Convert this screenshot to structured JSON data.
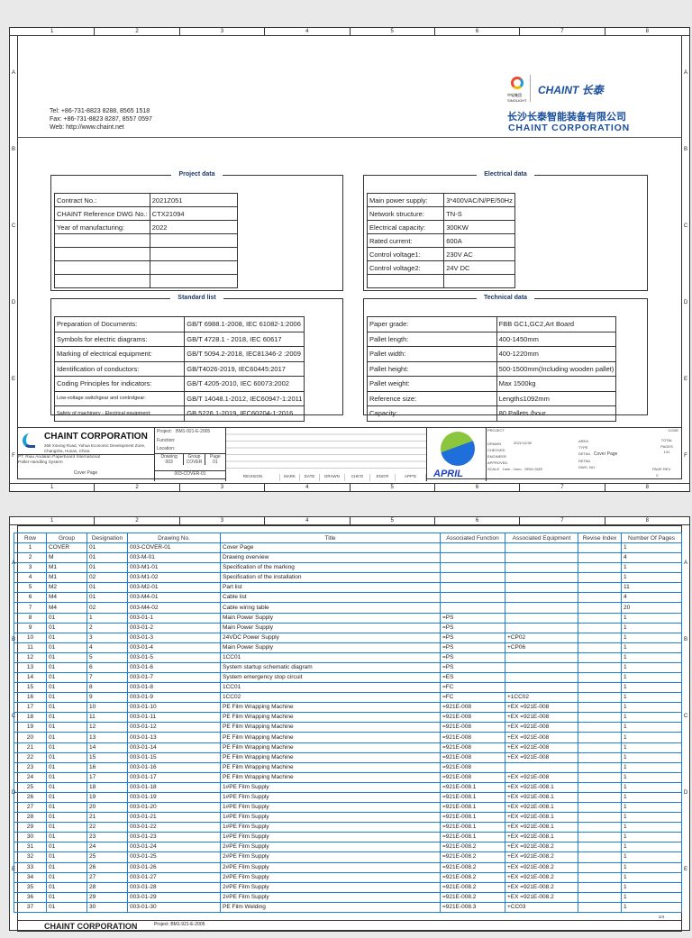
{
  "sheet_columns": [
    "1",
    "2",
    "3",
    "4",
    "5",
    "6",
    "7",
    "8"
  ],
  "sheet_rows": [
    "A",
    "B",
    "C",
    "D",
    "E",
    "F"
  ],
  "header": {
    "contact": [
      "Tel: +86-731-8823 8288, 8565 1518",
      "Fax: +86-731-8823 8287, 8557 0597",
      "Web: http://www.chaint.net"
    ],
    "logo_sinolight": "中轻集团 SINOLIGHT",
    "logo_chaint": "CHAINT 长泰",
    "company_cn": "长沙长泰智能装备有限公司",
    "company_en": "CHAINT CORPORATION"
  },
  "project_data": {
    "title": "Project data",
    "rows": [
      [
        "Contract No.:",
        "2021Z051"
      ],
      [
        "CHAINT Reference DWG No.:",
        "CTX21094"
      ],
      [
        "Year of manufacturing:",
        "2022"
      ],
      [
        "",
        ""
      ],
      [
        "",
        ""
      ],
      [
        "",
        ""
      ],
      [
        "",
        ""
      ]
    ]
  },
  "electrical_data": {
    "title": "Electrical data",
    "rows": [
      [
        "Main power supply:",
        "3*400VAC/N/PE/50Hz"
      ],
      [
        "Network structure:",
        "TN-S"
      ],
      [
        "Electrical capacity:",
        "300KW"
      ],
      [
        "Rated current:",
        "600A"
      ],
      [
        "Control voltage1:",
        "230V AC"
      ],
      [
        "Control voltage2:",
        "24V DC"
      ],
      [
        "",
        ""
      ]
    ]
  },
  "standard_list": {
    "title": "Standard list",
    "rows": [
      [
        "Preparation of Documents:",
        "GB/T 6988.1-2008, IEC 61082-1:2006"
      ],
      [
        "Symbols for electric diagrams:",
        "GB/T 4728.1 - 2018, IEC 60617"
      ],
      [
        "Marking of electrical equipment:",
        "GB/T 5094.2-2018, IEC81346-2 :2009"
      ],
      [
        "Identification of conductors:",
        "GB/T4026-2019, IEC60445:2017"
      ],
      [
        "Coding Principles for indicators:",
        "GB/T 4205-2010, IEC 60073:2002"
      ],
      [
        "Low-voltage switchgear and controlgear:",
        "GB/T 14048.1-2012, IEC60947-1:2011"
      ],
      [
        "Safety of machinery - Electrical equipment:",
        "GB 5226.1-2019, IEC60204-1:2016"
      ]
    ]
  },
  "technical_data": {
    "title": "Technical data",
    "rows": [
      [
        "Paper grade:",
        "FBB GC1,GC2,Art Board"
      ],
      [
        "Pallet length:",
        "400-1450mm"
      ],
      [
        "Pallet width:",
        "400-1220mm"
      ],
      [
        "Pallet height:",
        "500-1500mm(Including wooden pallet)"
      ],
      [
        "Pallet weight:",
        "Max 1500kg"
      ],
      [
        "Reference size:",
        "Length≤1092mm"
      ],
      [
        "Capacity:",
        "80 Pallets /hour"
      ]
    ]
  },
  "title_block": {
    "company": "CHAINT CORPORATION",
    "address": "268 Xinxing Road, Yuhua Economic Development Zone, Changsha, Hunan, China",
    "customer": "PT. Riau Andalan Paperboard International",
    "system": "Pallet Handling System",
    "page_name": "Cover Page",
    "project_label": "Project:",
    "project": "BM1-921-E-2005",
    "function_label": "Function:",
    "location_label": "Location:",
    "drawing_label": "Drawing",
    "group_label": "Group",
    "page_label": "Page",
    "drawing": "003",
    "group": "COVER",
    "page": "01",
    "drawing_no": "003-COVER-01",
    "revision_cols": [
      "REVISION",
      "MARK",
      "DATE",
      "DRAWN",
      "CHK'D",
      "ENG'R",
      "APP'D"
    ],
    "customer_logo": "APRIL",
    "right": {
      "project": "PROJECT",
      "drawn": "DRAWN",
      "drawn_date": "2021/12/30",
      "checked": "CHECKED",
      "engineer": "ENGINEER",
      "approved": "APPROVED",
      "scale": "SCALE",
      "scale_value": "1mm : 1mm",
      "orig_size": "ORIG.SIZE",
      "area": "AREA",
      "type": "TYPE",
      "detail": "DETAIL",
      "detail_value": "Cover Page",
      "detail2": "DETAIL",
      "dwg_no": "DWG. NO.",
      "total_pages": "TOTAL PAGES",
      "total_value": "131",
      "page": "PAGE",
      "page_value": "0",
      "rev": "REV.",
      "code": "CODE"
    }
  },
  "drawing_list": {
    "columns": [
      "Row",
      "Group",
      "Designation",
      "Drawing No.",
      "Title",
      "Associated Function",
      "Associated Equipment",
      "Revise Index",
      "Number Of Pages"
    ],
    "rows": [
      [
        "1",
        "COVER",
        "01",
        "003-COVER-01",
        "Cover Page",
        "",
        "",
        "",
        "1"
      ],
      [
        "2",
        "M",
        "01",
        "003-M-01",
        "Drawing overview",
        "",
        "",
        "",
        "4"
      ],
      [
        "3",
        "M1",
        "01",
        "003-M1-01",
        "Specification of the marking",
        "",
        "",
        "",
        "1"
      ],
      [
        "4",
        "M1",
        "02",
        "003-M1-02",
        "Specification of the installation",
        "",
        "",
        "",
        "1"
      ],
      [
        "5",
        "M2",
        "01",
        "003-M2-01",
        "Part list",
        "",
        "",
        "",
        "11"
      ],
      [
        "6",
        "M4",
        "01",
        "003-M4-01",
        "Cable list",
        "",
        "",
        "",
        "4"
      ],
      [
        "7",
        "M4",
        "02",
        "003-M4-02",
        "Cable wiring table",
        "",
        "",
        "",
        "20"
      ],
      [
        "8",
        "01",
        "1",
        "003-01-1",
        "Main Power Supply",
        "=PS",
        "",
        "",
        "1"
      ],
      [
        "9",
        "01",
        "2",
        "003-01-2",
        "Main Power Supply",
        "=PS",
        "",
        "",
        "1"
      ],
      [
        "10",
        "01",
        "3",
        "003-01-3",
        "24VDC Power Supply",
        "=PS",
        "+CP02",
        "",
        "1"
      ],
      [
        "11",
        "01",
        "4",
        "003-01-4",
        "Main Power Supply",
        "=PS",
        "+CP06",
        "",
        "1"
      ],
      [
        "12",
        "01",
        "5",
        "003-01-5",
        "1CC01",
        "=PS",
        "",
        "",
        "1"
      ],
      [
        "13",
        "01",
        "6",
        "003-01-6",
        "System startup schematic diagram",
        "=PS",
        "",
        "",
        "1"
      ],
      [
        "14",
        "01",
        "7",
        "003-01-7",
        "System emergency stop circuit",
        "=ES",
        "",
        "",
        "1"
      ],
      [
        "15",
        "01",
        "8",
        "003-01-8",
        "1CC01",
        "=FC",
        "",
        "",
        "1"
      ],
      [
        "16",
        "01",
        "9",
        "003-01-9",
        "1CC02",
        "=FC",
        "+1CC02",
        "",
        "1"
      ],
      [
        "17",
        "01",
        "10",
        "003-01-10",
        "PE Film Wrapping Machine",
        "=921E-008",
        "+EX =921E-008",
        "",
        "1"
      ],
      [
        "18",
        "01",
        "11",
        "003-01-11",
        "PE Film Wrapping Machine",
        "=921E-008",
        "+EX =921E-008",
        "",
        "1"
      ],
      [
        "19",
        "01",
        "12",
        "003-01-12",
        "PE Film Wrapping Machine",
        "=921E-008",
        "+EX =921E-008",
        "",
        "1"
      ],
      [
        "20",
        "01",
        "13",
        "003-01-13",
        "PE Film Wrapping Machine",
        "=921E-008",
        "+EX =921E-008",
        "",
        "1"
      ],
      [
        "21",
        "01",
        "14",
        "003-01-14",
        "PE Film Wrapping Machine",
        "=921E-008",
        "+EX =921E-008",
        "",
        "1"
      ],
      [
        "22",
        "01",
        "15",
        "003-01-15",
        "PE Film Wrapping Machine",
        "=921E-008",
        "+EX =921E-008",
        "",
        "1"
      ],
      [
        "23",
        "01",
        "16",
        "003-01-16",
        "PE Film Wrapping Machine",
        "=921E-008",
        "",
        "",
        "1"
      ],
      [
        "24",
        "01",
        "17",
        "003-01-17",
        "PE Film Wrapping Machine",
        "=921E-008",
        "+EX =921E-008",
        "",
        "1"
      ],
      [
        "25",
        "01",
        "18",
        "003-01-18",
        "1#PE Film Supply",
        "=921E-008.1",
        "+EX =921E-008.1",
        "",
        "1"
      ],
      [
        "26",
        "01",
        "19",
        "003-01-19",
        "1#PE Film Supply",
        "=921E-008.1",
        "+EX =921E-008.1",
        "",
        "1"
      ],
      [
        "27",
        "01",
        "20",
        "003-01-20",
        "1#PE Film Supply",
        "=921E-008.1",
        "+EX =921E-008.1",
        "",
        "1"
      ],
      [
        "28",
        "01",
        "21",
        "003-01-21",
        "1#PE Film Supply",
        "=921E-008.1",
        "+EX =921E-008.1",
        "",
        "1"
      ],
      [
        "29",
        "01",
        "22",
        "003-01-22",
        "1#PE Film Supply",
        "=921E-008.1",
        "+EX =921E-008.1",
        "",
        "1"
      ],
      [
        "30",
        "01",
        "23",
        "003-01-23",
        "1#PE Film Supply",
        "=921E-008.1",
        "+EX =921E-008.1",
        "",
        "1"
      ],
      [
        "31",
        "01",
        "24",
        "003-01-24",
        "2#PE Film Supply",
        "=921E-008.2",
        "+EX =921E-008.2",
        "",
        "1"
      ],
      [
        "32",
        "01",
        "25",
        "003-01-25",
        "2#PE Film Supply",
        "=921E-008.2",
        "+EX =921E-008.2",
        "",
        "1"
      ],
      [
        "33",
        "01",
        "26",
        "003-01-26",
        "2#PE Film Supply",
        "=921E-008.2",
        "+EX =921E-008.2",
        "",
        "1"
      ],
      [
        "34",
        "01",
        "27",
        "003-01-27",
        "2#PE Film Supply",
        "=921E-008.2",
        "+EX =921E-008.2",
        "",
        "1"
      ],
      [
        "35",
        "01",
        "28",
        "003-01-28",
        "2#PE Film Supply",
        "=921E-008.2",
        "+EX =921E-008.2",
        "",
        "1"
      ],
      [
        "36",
        "01",
        "29",
        "003-01-29",
        "2#PE Film Supply",
        "=921E-008.2",
        "+EX =921E-008.2",
        "",
        "1"
      ],
      [
        "37",
        "01",
        "30",
        "003-01-30",
        "PE Film Welding",
        "=921E-008.3",
        "+CC03",
        "",
        "1"
      ]
    ],
    "page_indicator": "1/4"
  },
  "colors": {
    "table_border": "#1e7fd6",
    "heading": "#1f3864",
    "chaint_blue": "#1b4f9c"
  }
}
